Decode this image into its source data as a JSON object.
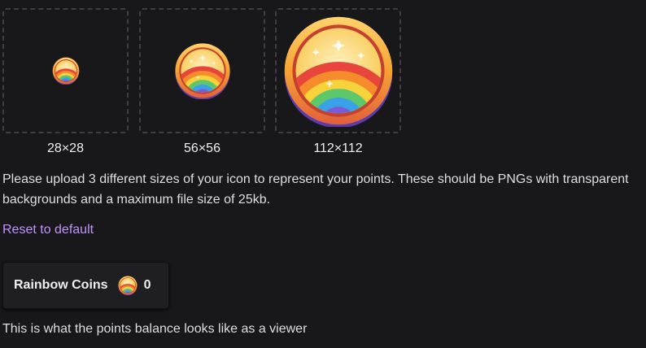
{
  "icons": {
    "small_label": "28×28",
    "medium_label": "56×56",
    "large_label": "112×112"
  },
  "description": "Please upload 3 different sizes of your icon to represent your points. These should be PNGs with transparent backgrounds and a maximum file size of 25kb.",
  "reset_label": "Reset to default",
  "balance": {
    "name": "Rainbow Coins",
    "count": "0"
  },
  "viewer_caption": "This is what the points balance looks like as a viewer",
  "colors": {
    "background": "#18181b",
    "accent_link": "#bf94ff",
    "coin_rim": "#f7b733",
    "rainbow": [
      "#e8453c",
      "#f68b2c",
      "#f7d23a",
      "#5cc86b",
      "#3aa0e8",
      "#7b5cd6"
    ]
  }
}
